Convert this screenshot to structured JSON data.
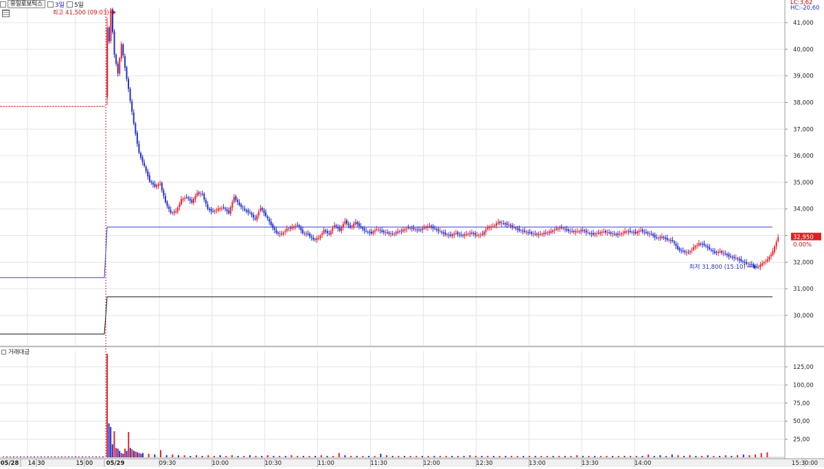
{
  "toolbar": {
    "stock_name": "유일로보틱스",
    "option_3": "3일",
    "option_5": "5일"
  },
  "indicators": {
    "lc": "LC:3,62",
    "hc": "HC:-20,60"
  },
  "annotations": {
    "high": "최고 41,500 (09:03)",
    "low": "최저 31,800 (15:10)"
  },
  "current_price": {
    "label": "32,950",
    "change": "0.00%",
    "color": "#e02020"
  },
  "volume_panel": {
    "title": "거래대금"
  },
  "colors": {
    "up": "#e8202a",
    "down": "#2230c8",
    "grid": "#e3e3e3",
    "ref_blue": "#3a3ad8",
    "ref_black": "#111111",
    "prev_close_red": "#d42020"
  },
  "chart_data": [
    {
      "type": "candlestick",
      "title": "",
      "yaxis_ticks": [
        "41,000",
        "40,000",
        "39,000",
        "38,000",
        "37,000",
        "36,000",
        "35,000",
        "34,000",
        "33,000",
        "32,000",
        "31,000",
        "30,000"
      ],
      "ylim": [
        29450,
        41700
      ],
      "x_ticks": [
        "05/28",
        "14:30",
        "15:00",
        "05/29",
        "09:30",
        "10:00",
        "10:30",
        "11:00",
        "11:30",
        "12:00",
        "12:30",
        "13:00",
        "13:30",
        "14:00",
        "14:30",
        "15:00",
        "15:30:00"
      ],
      "reference_lines": [
        {
          "name": "prev_close",
          "before": 37850
        },
        {
          "name": "upper",
          "before": 31420,
          "after": 33320
        },
        {
          "name": "lower",
          "before": 29300,
          "after": 30700
        }
      ],
      "price_path": [
        [
          "09:00",
          38200
        ],
        [
          "09:01",
          40800
        ],
        [
          "09:02",
          40300
        ],
        [
          "09:03",
          41500
        ],
        [
          "09:05",
          39800
        ],
        [
          "09:07",
          39100
        ],
        [
          "09:09",
          40200
        ],
        [
          "09:11",
          39300
        ],
        [
          "09:13",
          38500
        ],
        [
          "09:16",
          37200
        ],
        [
          "09:19",
          36100
        ],
        [
          "09:22",
          35600
        ],
        [
          "09:25",
          35050
        ],
        [
          "09:28",
          34850
        ],
        [
          "09:31",
          34950
        ],
        [
          "09:34",
          34250
        ],
        [
          "09:37",
          33850
        ],
        [
          "09:40",
          33900
        ],
        [
          "09:43",
          34350
        ],
        [
          "09:46",
          34450
        ],
        [
          "09:49",
          34250
        ],
        [
          "09:52",
          34600
        ],
        [
          "09:55",
          34550
        ],
        [
          "09:58",
          34000
        ],
        [
          "10:01",
          33900
        ],
        [
          "10:04",
          34000
        ],
        [
          "10:07",
          34050
        ],
        [
          "10:10",
          33850
        ],
        [
          "10:13",
          34450
        ],
        [
          "10:16",
          34150
        ],
        [
          "10:19",
          33950
        ],
        [
          "10:22",
          33850
        ],
        [
          "10:25",
          33600
        ],
        [
          "10:28",
          34050
        ],
        [
          "10:31",
          33750
        ],
        [
          "10:34",
          33400
        ],
        [
          "10:37",
          33100
        ],
        [
          "10:40",
          33050
        ],
        [
          "10:43",
          33250
        ],
        [
          "10:46",
          33300
        ],
        [
          "10:49",
          33400
        ],
        [
          "10:52",
          33100
        ],
        [
          "10:55",
          33050
        ],
        [
          "10:58",
          32850
        ],
        [
          "11:01",
          32900
        ],
        [
          "11:04",
          33200
        ],
        [
          "11:07",
          33050
        ],
        [
          "11:10",
          33400
        ],
        [
          "11:13",
          33200
        ],
        [
          "11:16",
          33550
        ],
        [
          "11:19",
          33300
        ],
        [
          "11:22",
          33500
        ],
        [
          "11:25",
          33300
        ],
        [
          "11:28",
          33150
        ],
        [
          "11:31",
          33100
        ],
        [
          "11:34",
          33250
        ],
        [
          "11:37",
          33150
        ],
        [
          "11:40",
          33100
        ],
        [
          "11:43",
          33050
        ],
        [
          "11:46",
          33150
        ],
        [
          "11:49",
          33200
        ],
        [
          "11:52",
          33300
        ],
        [
          "11:55",
          33250
        ],
        [
          "11:58",
          33200
        ],
        [
          "12:01",
          33300
        ],
        [
          "12:04",
          33350
        ],
        [
          "12:07",
          33250
        ],
        [
          "12:10",
          33150
        ],
        [
          "12:13",
          33050
        ],
        [
          "12:16",
          33000
        ],
        [
          "12:19",
          33100
        ],
        [
          "12:22",
          33000
        ],
        [
          "12:25",
          33050
        ],
        [
          "12:28",
          33100
        ],
        [
          "12:31",
          33000
        ],
        [
          "12:34",
          33050
        ],
        [
          "12:37",
          33300
        ],
        [
          "12:40",
          33350
        ],
        [
          "12:43",
          33500
        ],
        [
          "12:46",
          33450
        ],
        [
          "12:49",
          33400
        ],
        [
          "12:52",
          33300
        ],
        [
          "12:55",
          33200
        ],
        [
          "12:58",
          33150
        ],
        [
          "13:01",
          33100
        ],
        [
          "13:04",
          33050
        ],
        [
          "13:07",
          33050
        ],
        [
          "13:10",
          33100
        ],
        [
          "13:13",
          33150
        ],
        [
          "13:16",
          33250
        ],
        [
          "13:19",
          33300
        ],
        [
          "13:22",
          33200
        ],
        [
          "13:25",
          33150
        ],
        [
          "13:28",
          33150
        ],
        [
          "13:31",
          33200
        ],
        [
          "13:34",
          33100
        ],
        [
          "13:37",
          33050
        ],
        [
          "13:40",
          33100
        ],
        [
          "13:43",
          33150
        ],
        [
          "13:46",
          33100
        ],
        [
          "13:49",
          33050
        ],
        [
          "13:52",
          33050
        ],
        [
          "13:55",
          33150
        ],
        [
          "13:58",
          33150
        ],
        [
          "14:01",
          33100
        ],
        [
          "14:04",
          33200
        ],
        [
          "14:07",
          33100
        ],
        [
          "14:10",
          33050
        ],
        [
          "14:13",
          32900
        ],
        [
          "14:16",
          32950
        ],
        [
          "14:19",
          32850
        ],
        [
          "14:22",
          32800
        ],
        [
          "14:25",
          32500
        ],
        [
          "14:28",
          32400
        ],
        [
          "14:31",
          32350
        ],
        [
          "14:34",
          32550
        ],
        [
          "14:37",
          32700
        ],
        [
          "14:40",
          32650
        ],
        [
          "14:43",
          32500
        ],
        [
          "14:46",
          32350
        ],
        [
          "14:49",
          32400
        ],
        [
          "14:52",
          32300
        ],
        [
          "14:55",
          32200
        ],
        [
          "14:58",
          32150
        ],
        [
          "15:01",
          32050
        ],
        [
          "15:04",
          31950
        ],
        [
          "15:07",
          31900
        ],
        [
          "15:10",
          31800
        ],
        [
          "15:13",
          31950
        ],
        [
          "15:16",
          32100
        ],
        [
          "15:19",
          32400
        ],
        [
          "15:22",
          32950
        ]
      ]
    },
    {
      "type": "bar",
      "title": "거래대금",
      "yaxis_ticks": [
        "125,00",
        "100,00",
        "75,00",
        "50,00",
        "25,00"
      ],
      "ylim": [
        0,
        150
      ],
      "series_up_down": true,
      "values": [
        [
          143,
          "up"
        ],
        [
          47,
          "down"
        ],
        [
          42,
          "down"
        ],
        [
          18,
          "down"
        ],
        [
          36,
          "up"
        ],
        [
          13,
          "up"
        ],
        [
          12,
          "down"
        ],
        [
          9,
          "down"
        ],
        [
          6,
          "up"
        ],
        [
          5,
          "down"
        ],
        [
          12,
          "up"
        ],
        [
          9,
          "down"
        ],
        [
          35,
          "up"
        ],
        [
          13,
          "down"
        ],
        [
          11,
          "up"
        ],
        [
          9,
          "down"
        ],
        [
          8,
          "up"
        ],
        [
          7,
          "down"
        ],
        [
          6,
          "up"
        ],
        [
          5,
          "down"
        ],
        [
          6,
          "down"
        ],
        [
          5,
          "up"
        ],
        [
          4,
          "down"
        ],
        [
          10,
          "up"
        ],
        [
          3,
          "down"
        ],
        [
          4,
          "up"
        ],
        [
          3,
          "down"
        ],
        [
          3,
          "up"
        ],
        [
          2,
          "down"
        ],
        [
          3,
          "up"
        ],
        [
          2,
          "down"
        ],
        [
          3,
          "up"
        ],
        [
          2,
          "up"
        ],
        [
          3,
          "down"
        ],
        [
          2,
          "up"
        ],
        [
          3,
          "up"
        ],
        [
          2,
          "down"
        ],
        [
          2,
          "up"
        ],
        [
          3,
          "down"
        ],
        [
          2,
          "up"
        ],
        [
          2,
          "down"
        ],
        [
          3,
          "up"
        ],
        [
          2,
          "down"
        ],
        [
          2,
          "up"
        ],
        [
          2,
          "down"
        ],
        [
          3,
          "up"
        ],
        [
          2,
          "up"
        ],
        [
          2,
          "down"
        ],
        [
          2,
          "up"
        ],
        [
          2,
          "down"
        ],
        [
          3,
          "up"
        ],
        [
          2,
          "down"
        ],
        [
          2,
          "up"
        ],
        [
          6,
          "up"
        ],
        [
          3,
          "down"
        ],
        [
          2,
          "up"
        ],
        [
          2,
          "down"
        ],
        [
          2,
          "up"
        ],
        [
          2,
          "down"
        ],
        [
          2,
          "up"
        ],
        [
          5,
          "down"
        ],
        [
          3,
          "up"
        ],
        [
          2,
          "down"
        ],
        [
          2,
          "up"
        ],
        [
          2,
          "down"
        ],
        [
          2,
          "up"
        ],
        [
          2,
          "up"
        ],
        [
          2,
          "down"
        ],
        [
          2,
          "up"
        ],
        [
          2,
          "down"
        ],
        [
          2,
          "up"
        ],
        [
          2,
          "up"
        ],
        [
          2,
          "down"
        ],
        [
          2,
          "up"
        ],
        [
          2,
          "down"
        ],
        [
          3,
          "up"
        ],
        [
          2,
          "up"
        ],
        [
          2,
          "down"
        ],
        [
          2,
          "up"
        ],
        [
          2,
          "down"
        ],
        [
          2,
          "up"
        ],
        [
          2,
          "down"
        ],
        [
          2,
          "up"
        ],
        [
          2,
          "up"
        ],
        [
          2,
          "down"
        ],
        [
          2,
          "up"
        ],
        [
          2,
          "down"
        ],
        [
          2,
          "up"
        ],
        [
          2,
          "up"
        ],
        [
          2,
          "down"
        ],
        [
          2,
          "up"
        ],
        [
          2,
          "down"
        ],
        [
          2,
          "up"
        ],
        [
          3,
          "up"
        ],
        [
          2,
          "down"
        ],
        [
          2,
          "up"
        ],
        [
          2,
          "down"
        ],
        [
          2,
          "up"
        ],
        [
          2,
          "up"
        ],
        [
          2,
          "down"
        ],
        [
          2,
          "up"
        ],
        [
          2,
          "down"
        ],
        [
          2,
          "up"
        ],
        [
          2,
          "up"
        ],
        [
          2,
          "down"
        ],
        [
          4,
          "up"
        ],
        [
          2,
          "down"
        ],
        [
          3,
          "down"
        ],
        [
          2,
          "up"
        ],
        [
          4,
          "down"
        ],
        [
          3,
          "up"
        ],
        [
          2,
          "down"
        ],
        [
          3,
          "up"
        ],
        [
          2,
          "down"
        ],
        [
          2,
          "up"
        ],
        [
          3,
          "down"
        ],
        [
          2,
          "up"
        ],
        [
          2,
          "down"
        ],
        [
          3,
          "up"
        ],
        [
          2,
          "down"
        ],
        [
          3,
          "up"
        ],
        [
          4,
          "down"
        ],
        [
          3,
          "up"
        ],
        [
          4,
          "up"
        ],
        [
          6,
          "up"
        ],
        [
          7,
          "up"
        ]
      ]
    }
  ]
}
